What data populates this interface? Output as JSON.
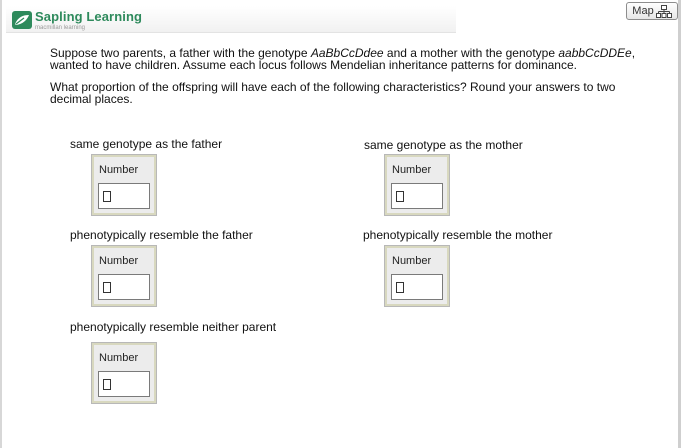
{
  "brand": {
    "name": "Sapling Learning",
    "subtitle": "macmillan learning",
    "logo_icon": "sapling-leaf-logo",
    "accent_color": "#2e8a5c"
  },
  "map_button": {
    "label": "Map",
    "icon": "sitemap-icon"
  },
  "question": {
    "paragraph1": {
      "before_father": "Suppose two parents, a father with the genotype ",
      "father_genotype": "AaBbCcDdee",
      "between": " and a mother with the genotype ",
      "mother_genotype": "aabbCcDDEe",
      "after": ", wanted to have children. Assume each locus follows Mendelian inheritance patterns for dominance."
    },
    "paragraph2": "What proportion of the offspring will have each of the following characteristics? Round your answers to two decimal places."
  },
  "answers": [
    {
      "label": "same genotype as the father",
      "caption": "Number",
      "value": ""
    },
    {
      "label": "same genotype as the mother",
      "caption": "Number",
      "value": ""
    },
    {
      "label": "phenotypically resemble the father",
      "caption": "Number",
      "value": ""
    },
    {
      "label": "phenotypically resemble the mother",
      "caption": "Number",
      "value": ""
    },
    {
      "label": "phenotypically resemble neither parent",
      "caption": "Number",
      "value": ""
    }
  ]
}
